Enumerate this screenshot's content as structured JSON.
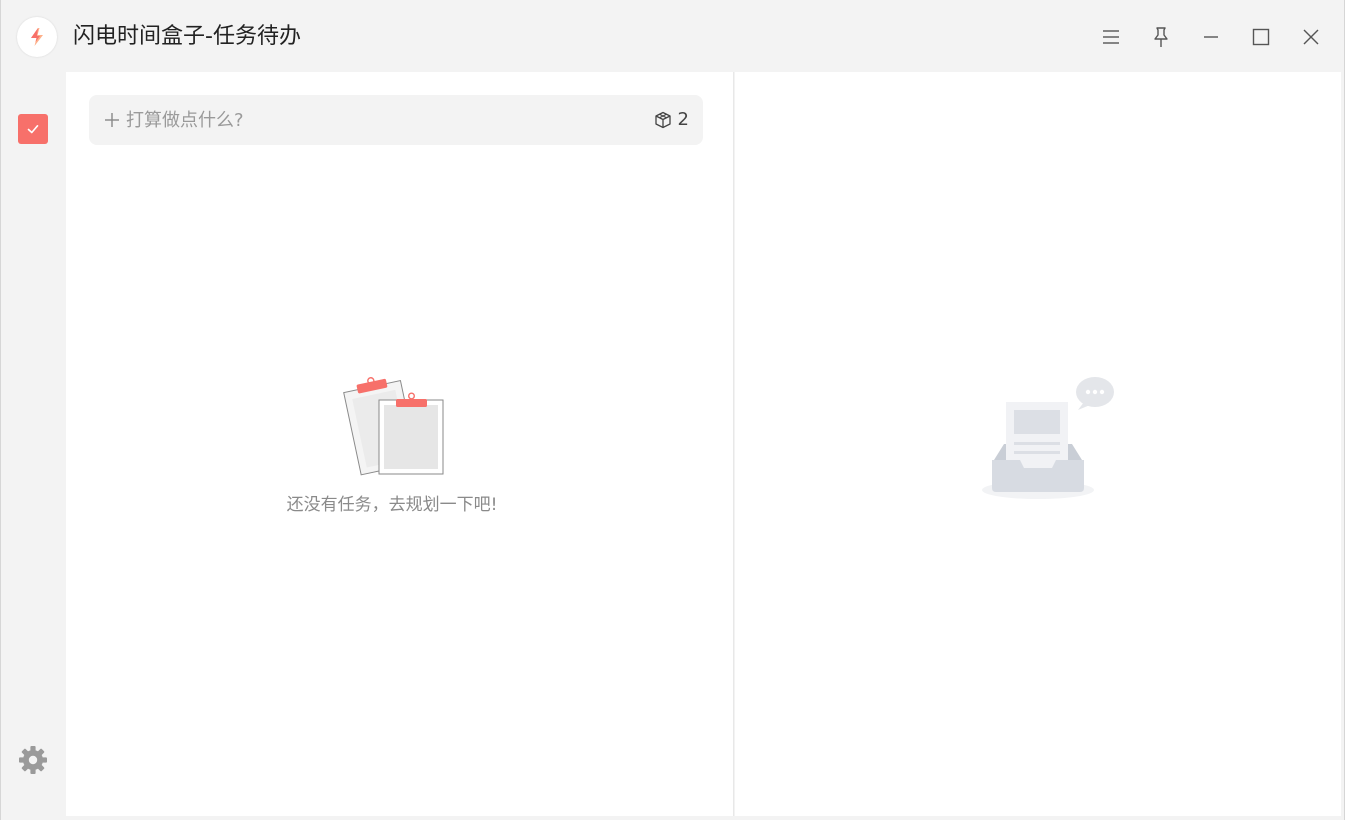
{
  "window": {
    "title": "闪电时间盒子-任务待办",
    "controls": [
      "menu-icon",
      "pin-icon",
      "minimize-icon",
      "maximize-icon",
      "close-icon"
    ]
  },
  "sidebar": {
    "items": [
      {
        "name": "todo",
        "icon": "checkbox-checked-icon",
        "active": true
      }
    ],
    "settings_icon": "gear-icon"
  },
  "task_input": {
    "placeholder": "打算做点什么?",
    "icon": "plus-icon",
    "counter_icon": "cube-icon",
    "count": "2"
  },
  "left_empty": {
    "illustration": "clipboards-illustration",
    "message": "还没有任务，去规划一下吧!"
  },
  "right_empty": {
    "illustration": "inbox-document-illustration"
  },
  "colors": {
    "accent": "#f7706a",
    "window_bg": "#f3f3f3",
    "panel_bg": "#ffffff"
  }
}
